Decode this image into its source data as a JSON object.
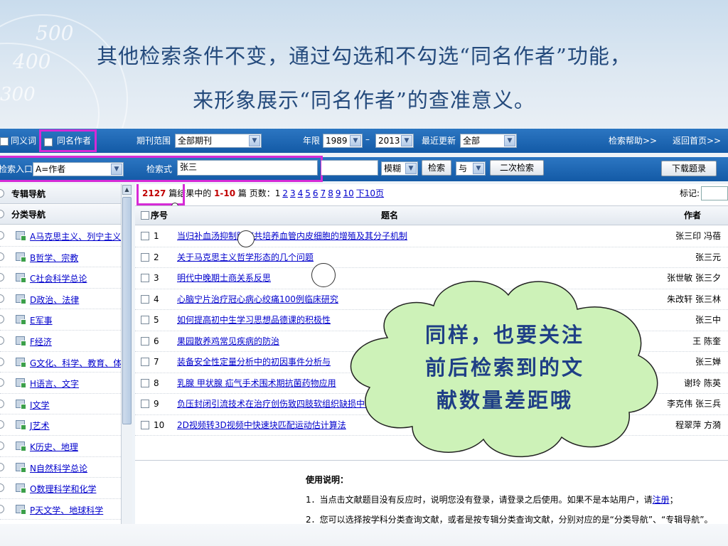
{
  "slide": {
    "title_line1": "其他检索条件不变，通过勾选和不勾选“同名作者”功能，",
    "title_line2": "来形象展示“同名作者”的查准意义。",
    "deco_500": "500",
    "deco_400": "400",
    "deco_300": "300"
  },
  "filters": {
    "synonym_label": "同义词",
    "same_name_label": "同名作者",
    "journal_range_label": "期刊范围",
    "journal_range_value": "全部期刊",
    "year_label": "年限",
    "year_from": "1989",
    "year_sep": "–",
    "year_to": "2013",
    "update_label": "最近更新",
    "update_value": "全部",
    "help_link": "检索帮助>>",
    "home_link": "返回首页>>"
  },
  "search": {
    "entry_label": "检索入口",
    "entry_value": "A=作者",
    "expr_label": "检索式",
    "expr_value": "张三",
    "match_value": "模糊",
    "search_button": "检索",
    "logic_value": "与",
    "secondary_button": "二次检索",
    "download_button": "下载题录"
  },
  "nav": {
    "special_nav": "专辑导航",
    "category_nav": "分类导航",
    "items": [
      "A马克思主义、列宁主义",
      "B哲学、宗教",
      "C社会科学总论",
      "D政治、法律",
      "E军事",
      "F经济",
      "G文化、科学、教育、体育",
      "H语言、文字",
      "I文学",
      "J艺术",
      "K历史、地理",
      "N自然科学总论",
      "O数理科学和化学",
      "P天文学、地球科学"
    ]
  },
  "results": {
    "count": "2127",
    "info_middle": " 篇结果中的 ",
    "range": "1-10",
    "info_pages": " 篇 页数：",
    "current_page": "1",
    "pages": [
      "2",
      "3",
      "4",
      "5",
      "6",
      "7",
      "8",
      "9",
      "10"
    ],
    "next_ten": "下10页",
    "mark_label": "标记:",
    "head_no": "序号",
    "head_title": "题名",
    "head_author": "作者",
    "rows": [
      {
        "no": "1",
        "title": "当归补血汤抑制肿瘤共培养血管内皮细胞的增殖及其分子机制",
        "author": "张三印 冯蓓"
      },
      {
        "no": "2",
        "title": "关于马克思主义哲学形态的几个问题",
        "author": "张三元"
      },
      {
        "no": "3",
        "title": "明代中晚期士商关系反思",
        "author": "张世敏 张三夕"
      },
      {
        "no": "4",
        "title": "心脑宁片治疗冠心病心绞痛100例临床研究",
        "author": "朱改轩 张三林"
      },
      {
        "no": "5",
        "title": "如何提高初中生学习思想品德课的积极性",
        "author": "张三中"
      },
      {
        "no": "6",
        "title": "果园散养鸡常见疾病的防治",
        "author": "王 陈奎"
      },
      {
        "no": "7",
        "title": "装备安全性定量分析中的初因事件分析与",
        "author": "张三婵"
      },
      {
        "no": "8",
        "title": "乳腺 甲状腺 疝气手术围术期抗菌药物应用",
        "author": "谢玲 陈英"
      },
      {
        "no": "9",
        "title": "负压封闭引流技术在治疗创伤致四肢软组织缺损中的",
        "author": "李克伟 张三兵"
      },
      {
        "no": "10",
        "title": "2D视频转3D视频中快速块匹配运动估计算法",
        "author": "程翠萍 方漪"
      }
    ]
  },
  "usage": {
    "title": "使用说明：",
    "line1": "1．当点击文献题目没有反应时，说明您没有登录，请登录之后使用。如果不是本站用户，请",
    "register_link": "注册",
    "line1_end": "；",
    "line2": "2．您可以选择按学科分类查询文献，或者是按专辑分类查询文献，分别对应的是“分类导航”、“专辑导航”。"
  },
  "callout": {
    "line1": "同样，也要关注",
    "line2": "前后检索到的文",
    "line3": "献数量差距哦"
  },
  "colors": {
    "toolbar_blue": "#1f68b6",
    "highlight_magenta": "#d62ad6",
    "link_blue": "#0000cc",
    "count_red": "#c00000",
    "cloud_fill": "#cdf2b8",
    "callout_text": "#1f3f86"
  }
}
